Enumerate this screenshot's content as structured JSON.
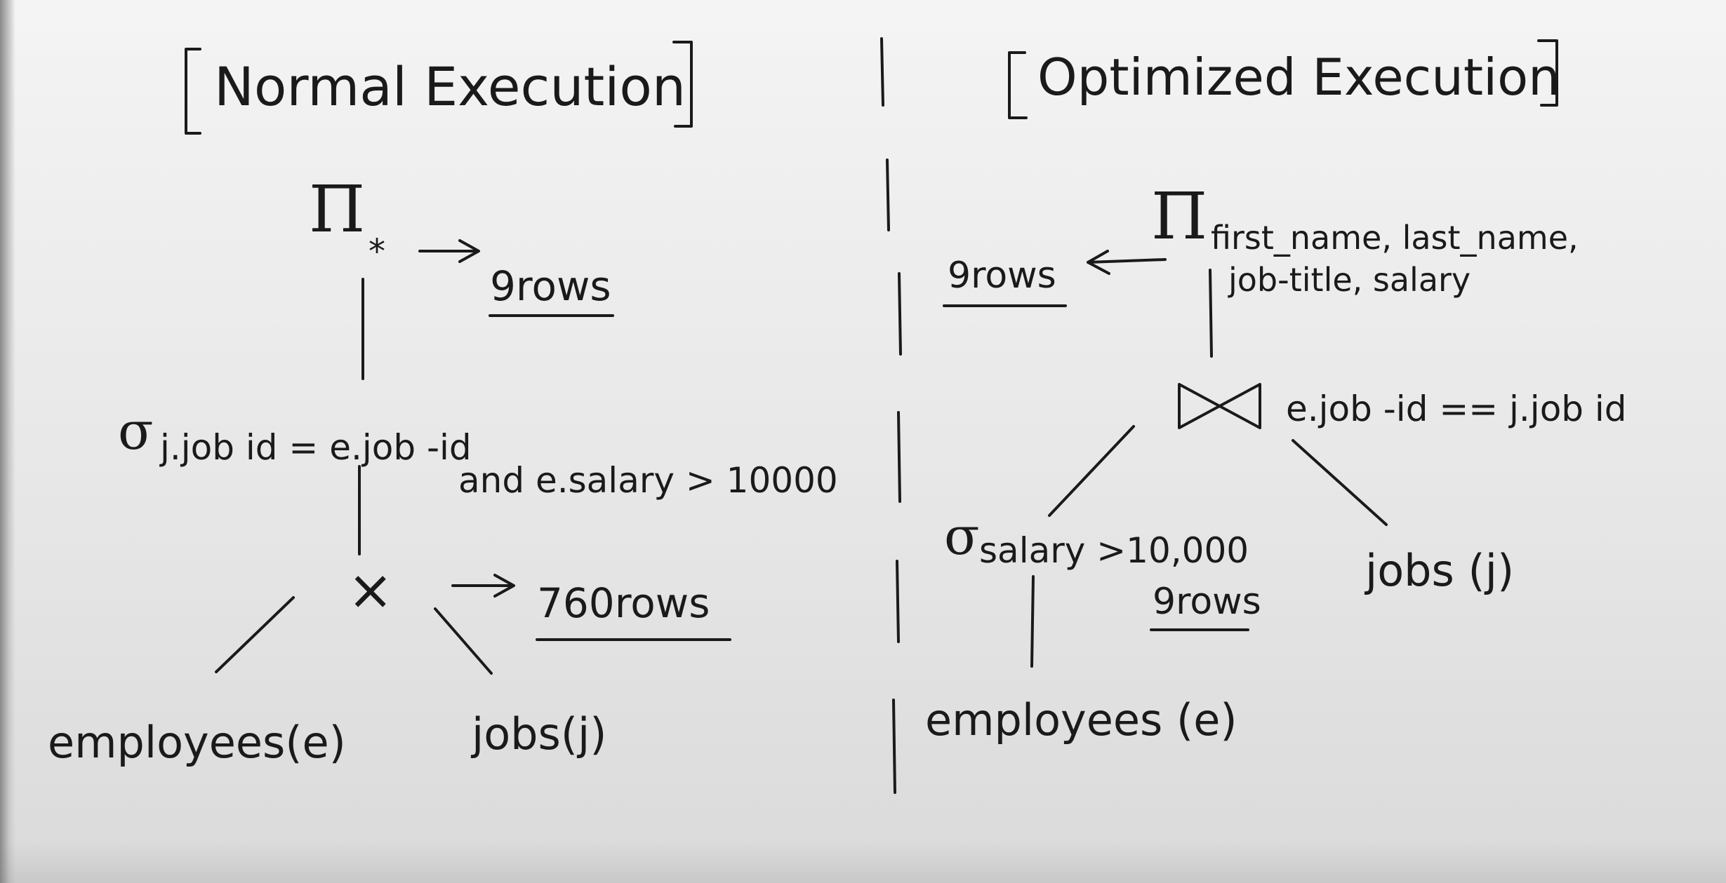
{
  "normal": {
    "title": "Normal Execution",
    "projection_symbol": "Π",
    "projection_subscript": "*",
    "projection_rows": "9rows",
    "selection_symbol": "σ",
    "selection_line1": "j.job id = e.job -id",
    "selection_line2": "and e.salary > 10000",
    "cross_symbol": "×",
    "cross_rows": "760rows",
    "leaf_left": "employees(e)",
    "leaf_right": "jobs(j)"
  },
  "optimized": {
    "title": "Optimized Execution",
    "projection_symbol": "Π",
    "projection_line1": "first_name, last_name,",
    "projection_line2": "job-title, salary",
    "projection_rows": "9rows",
    "join_condition": "e.job -id == j.job id",
    "selection_symbol": "σ",
    "selection_condition": "salary >10,000",
    "selection_rows": "9rows",
    "leaf_left": "employees (e)",
    "leaf_right": "jobs (j)"
  },
  "colors": {
    "ink": "#1a1a1a",
    "paper": "#ececec"
  }
}
